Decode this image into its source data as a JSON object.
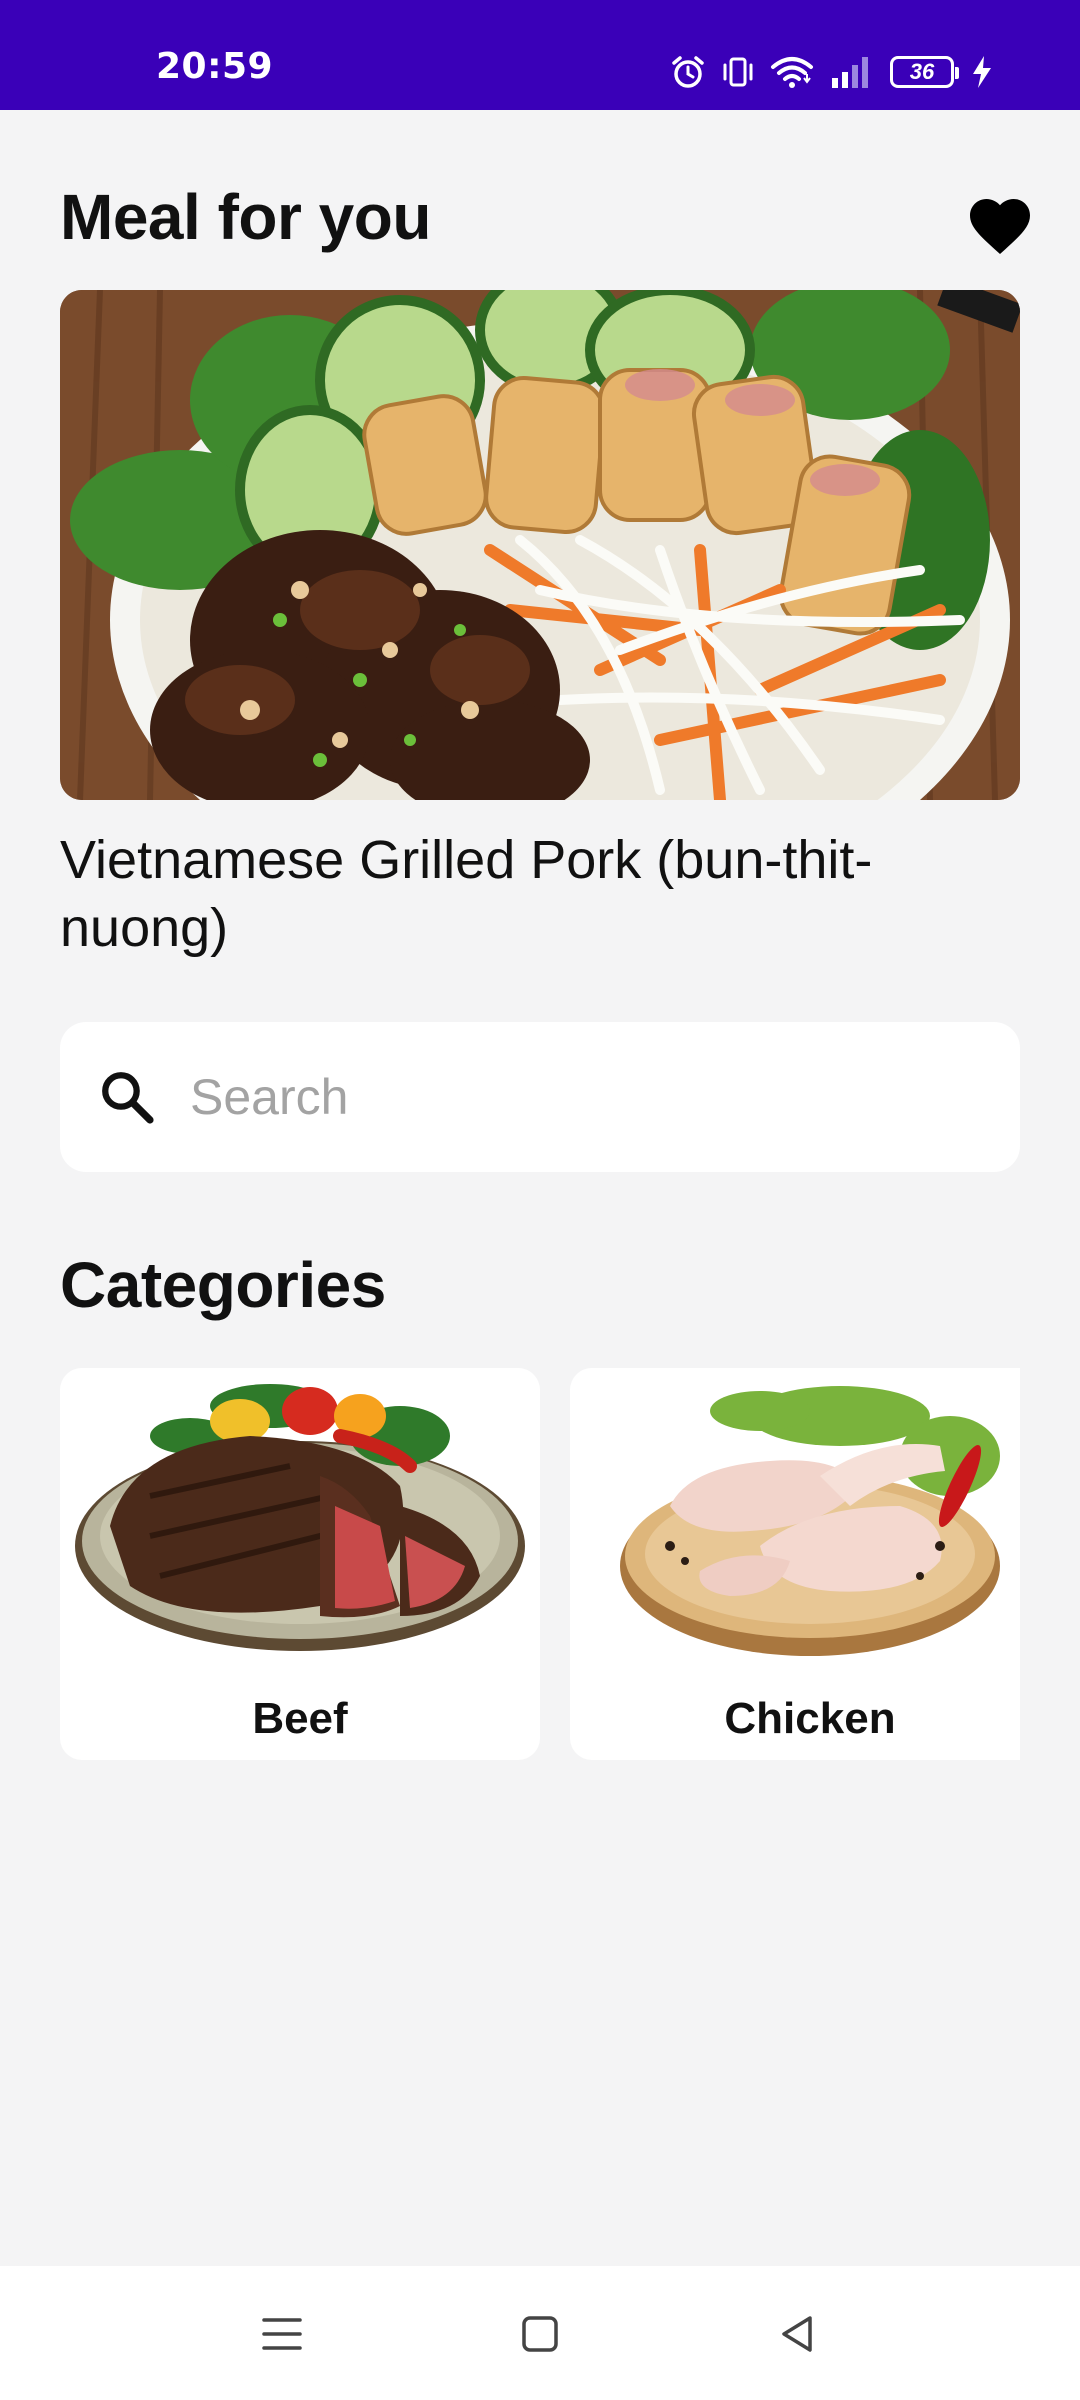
{
  "status_bar": {
    "time": "20:59",
    "battery_level": "36",
    "icons": [
      "alarm-icon",
      "vibrate-icon",
      "wifi-icon",
      "signal-icon",
      "battery-icon",
      "charging-icon"
    ],
    "background": "#3a00b8"
  },
  "header": {
    "title": "Meal for you",
    "favorite_icon": "heart-icon"
  },
  "featured_meal": {
    "name": "Vietnamese Grilled Pork (bun-thit-nuong)",
    "image": "meal-photo"
  },
  "search": {
    "placeholder": "Search",
    "value": "",
    "icon": "search-icon"
  },
  "categories": {
    "title": "Categories",
    "items": [
      {
        "label": "Beef",
        "image": "beef-steak-photo"
      },
      {
        "label": "Chicken",
        "image": "raw-chicken-photo"
      }
    ]
  },
  "nav_bar": {
    "buttons": [
      "menu-icon",
      "home-icon",
      "back-icon"
    ]
  }
}
